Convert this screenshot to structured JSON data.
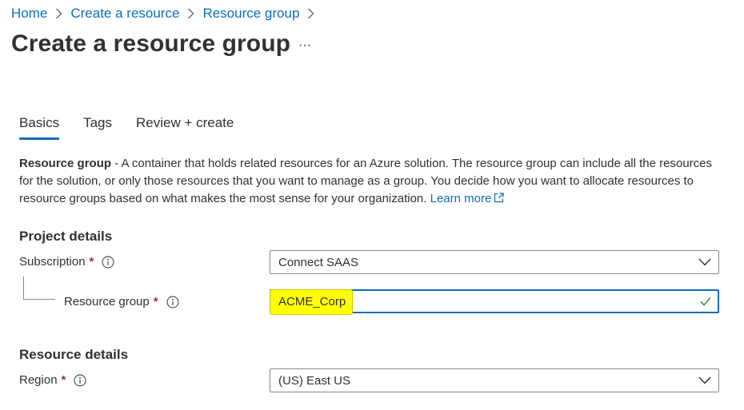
{
  "breadcrumb": {
    "items": [
      "Home",
      "Create a resource",
      "Resource group"
    ]
  },
  "page": {
    "title": "Create a resource group",
    "more_label": "···"
  },
  "tabs": [
    {
      "label": "Basics",
      "active": true
    },
    {
      "label": "Tags",
      "active": false
    },
    {
      "label": "Review + create",
      "active": false
    }
  ],
  "description": {
    "term": "Resource group",
    "text": " - A container that holds related resources for an Azure solution. The resource group can include all the resources for the solution, or only those resources that you want to manage as a group. You decide how you want to allocate resources to resource groups based on what makes the most sense for your organization. ",
    "link": "Learn more"
  },
  "project_details": {
    "heading": "Project details",
    "subscription": {
      "label": "Subscription",
      "required": "*",
      "value": "Connect SAAS"
    },
    "resource_group": {
      "label": "Resource group",
      "required": "*",
      "value": "ACME_Corp"
    }
  },
  "resource_details": {
    "heading": "Resource details",
    "region": {
      "label": "Region",
      "required": "*",
      "value": "(US) East US"
    }
  },
  "colors": {
    "link": "#0f6cbd",
    "highlight": "#ffff00",
    "required": "#a4262c",
    "valid": "#107c10"
  }
}
